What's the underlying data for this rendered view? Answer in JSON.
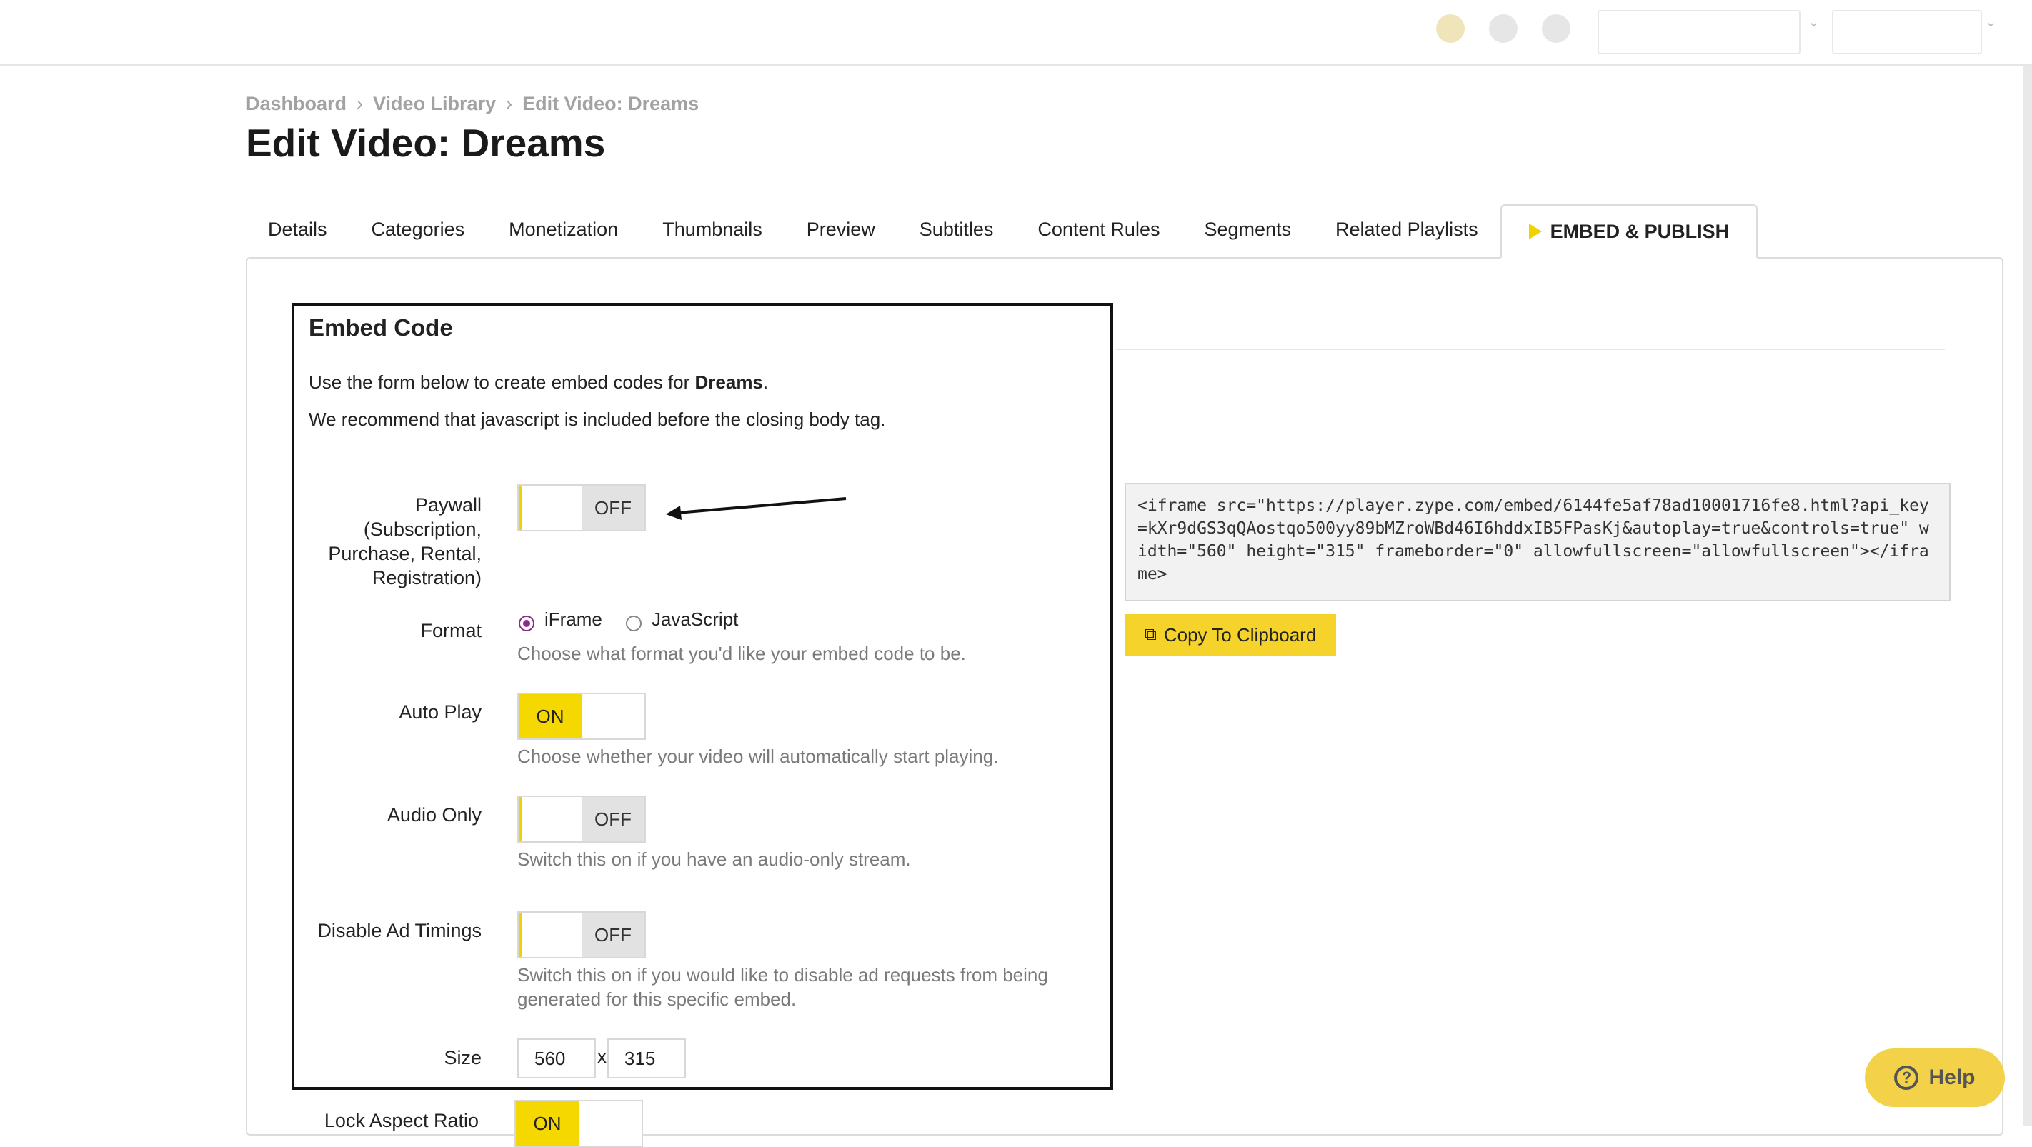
{
  "breadcrumb": {
    "items": [
      "Dashboard",
      "Video Library",
      "Edit Video: Dreams"
    ],
    "separator": "›"
  },
  "page": {
    "title": "Edit Video: Dreams"
  },
  "tabs": [
    {
      "label": "Details"
    },
    {
      "label": "Categories"
    },
    {
      "label": "Monetization"
    },
    {
      "label": "Thumbnails"
    },
    {
      "label": "Preview"
    },
    {
      "label": "Subtitles"
    },
    {
      "label": "Content Rules"
    },
    {
      "label": "Segments"
    },
    {
      "label": "Related Playlists"
    },
    {
      "label": "EMBED & PUBLISH",
      "active": true
    }
  ],
  "embed": {
    "title": "Embed Code",
    "intro_prefix": "Use the form below to create embed codes for ",
    "intro_video": "Dreams",
    "intro_suffix": ".",
    "recommend": "We recommend that javascript is included before the closing body tag.",
    "paywall": {
      "label_lines": [
        "Paywall",
        "(Subscription,",
        "Purchase, Rental,",
        "Registration)"
      ],
      "state": "OFF"
    },
    "format": {
      "label": "Format",
      "options": [
        "iFrame",
        "JavaScript"
      ],
      "selected": "iFrame",
      "help": "Choose what format you'd like your embed code to be."
    },
    "autoplay": {
      "label": "Auto Play",
      "state": "ON",
      "help": "Choose whether your video will automatically start playing."
    },
    "audio_only": {
      "label": "Audio Only",
      "state": "OFF",
      "help": "Switch this on if you have an audio-only stream."
    },
    "disable_ad_timings": {
      "label": "Disable Ad Timings",
      "state": "OFF",
      "help_lines": [
        "Switch this on if you would like to disable ad requests from being",
        "generated for this specific embed."
      ]
    },
    "size": {
      "label": "Size",
      "width": "560",
      "separator": "x",
      "height": "315"
    },
    "lock_aspect": {
      "label": "Lock Aspect Ratio",
      "state": "ON"
    },
    "code": "<iframe src=\"https://player.zype.com/embed/6144fe5af78ad10001716fe8.html?api_key=kXr9dGS3qQAostqo500yy89bMZroWBd46I6hddxIB5FPasKj&autoplay=true&controls=true\" width=\"560\" height=\"315\" frameborder=\"0\" allowfullscreen=\"allowfullscreen\"></iframe>",
    "copy_label": "Copy To Clipboard"
  },
  "help_button": {
    "label": "Help"
  },
  "colors": {
    "accent": "#f5d800",
    "sidebar_bg": "#000000",
    "radio": "#8a2b8a"
  }
}
